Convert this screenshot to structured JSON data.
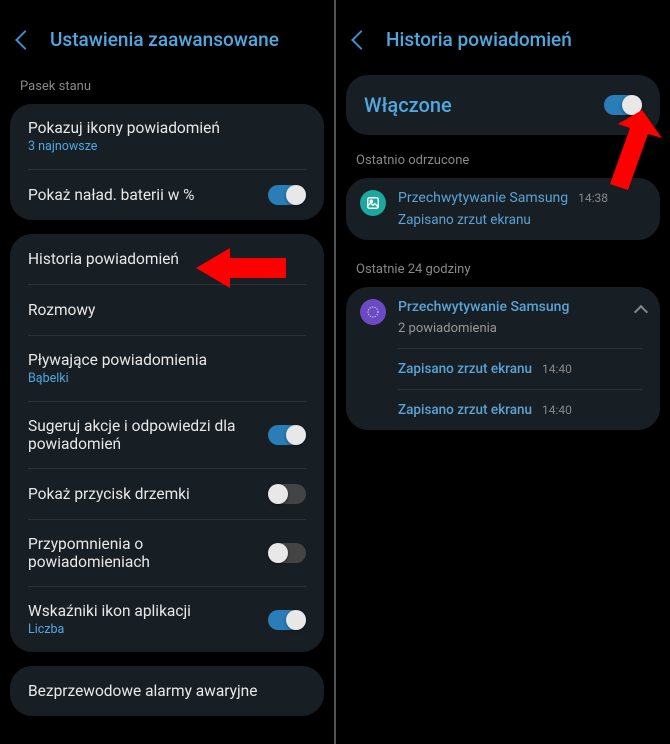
{
  "left": {
    "title": "Ustawienia zaawansowane",
    "section1_label": "Pasek stanu",
    "rows": {
      "icons": {
        "title": "Pokazuj ikony powiadomień",
        "sub": "3 najnowsze"
      },
      "battery": {
        "title": "Pokaż naład. baterii w %"
      },
      "history": {
        "title": "Historia powiadomień"
      },
      "conversations": {
        "title": "Rozmowy"
      },
      "floating": {
        "title": "Pływające powiadomienia",
        "sub": "Bąbelki"
      },
      "suggest": {
        "title": "Sugeruj akcje i odpowiedzi dla powiadomień"
      },
      "snooze": {
        "title": "Pokaż przycisk drzemki"
      },
      "reminders": {
        "title": "Przypomnienia o powiadomieniach"
      },
      "badges": {
        "title": "Wskaźniki ikon aplikacji",
        "sub": "Liczba"
      },
      "wireless": {
        "title": "Bezprzewodowe alarmy awaryjne"
      }
    }
  },
  "right": {
    "title": "Historia powiadomień",
    "enabled": "Włączone",
    "section1_label": "Ostatnio odrzucone",
    "section2_label": "Ostatnie 24 godziny",
    "notif1": {
      "app": "Przechwytywanie Samsung",
      "time": "14:38",
      "msg": "Zapisano zrzut ekranu"
    },
    "group1": {
      "app": "Przechwytywanie Samsung",
      "count": "2 powiadomienia"
    },
    "sub1": {
      "msg": "Zapisano zrzut ekranu",
      "time": "14:40"
    },
    "sub2": {
      "msg": "Zapisano zrzut ekranu",
      "time": "14:40"
    }
  }
}
